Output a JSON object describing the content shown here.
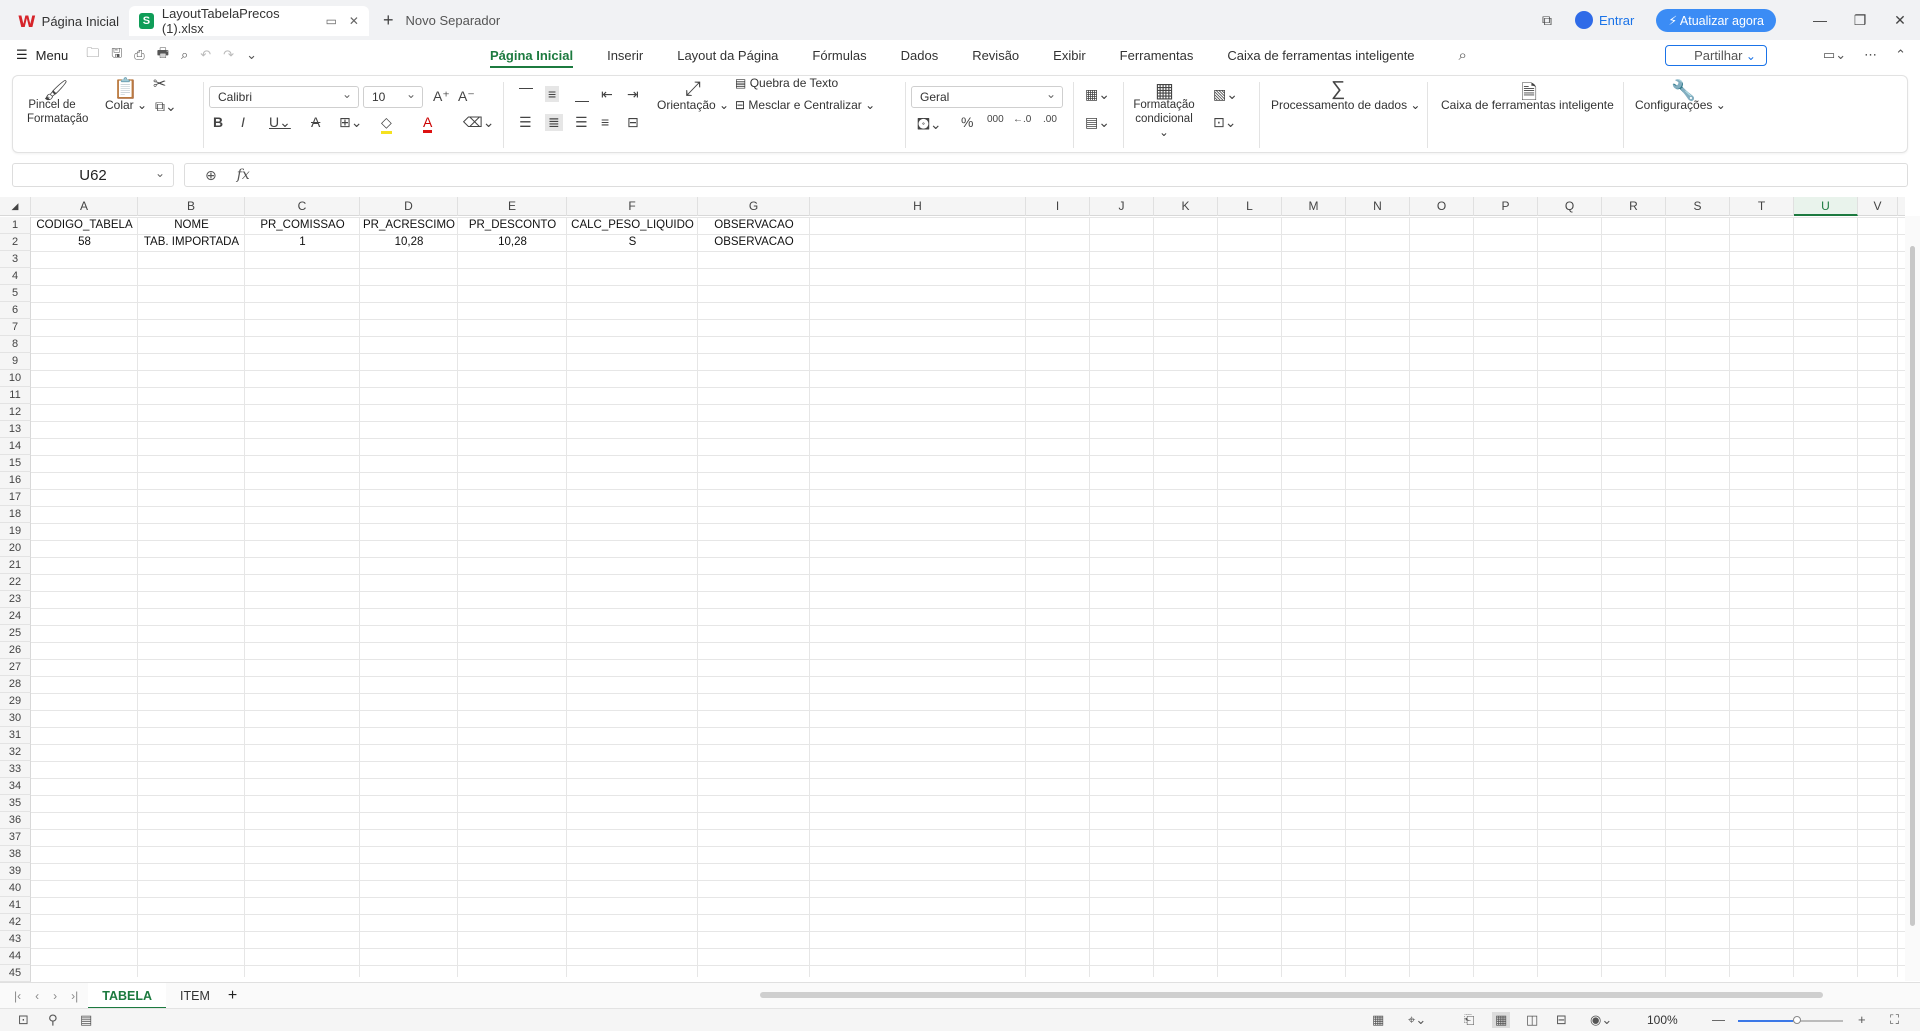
{
  "titlebar": {
    "home_tab": "Página Inicial",
    "doc_tab": "LayoutTabelaPrecos (1).xlsx",
    "new_tab": "Novo Separador",
    "signin": "Entrar",
    "upgrade": "Atualizar agora"
  },
  "menubar": {
    "menu": "Menu",
    "tabs": [
      "Página Inicial",
      "Inserir",
      "Layout da Página",
      "Fórmulas",
      "Dados",
      "Revisão",
      "Exibir",
      "Ferramentas",
      "Caixa de ferramentas inteligente"
    ],
    "share": "Partilhar"
  },
  "ribbon": {
    "format_painter": "Pincel de Formatação",
    "paste": "Colar",
    "font_name": "Calibri",
    "font_size": "10",
    "wrap_text": "Quebra de Texto",
    "orientation": "Orientação",
    "merge_center": "Mesclar e Centralizar",
    "number_format": "Geral",
    "cond_format": "Formatação condicional",
    "data_processing": "Processamento de dados",
    "smart_toolbox": "Caixa de ferramentas inteligente",
    "settings": "Configurações",
    "accent_color": "#1c7a3f"
  },
  "formula_bar": {
    "name_box": "U62",
    "fx": "fx",
    "value": ""
  },
  "columns": [
    "A",
    "B",
    "C",
    "D",
    "E",
    "F",
    "G",
    "H",
    "I",
    "J",
    "K",
    "L",
    "M",
    "N",
    "O",
    "P",
    "Q",
    "R",
    "S",
    "T",
    "U",
    "V"
  ],
  "selected_column": "U",
  "rows": [
    [
      "CODIGO_TABELA",
      "NOME",
      "PR_COMISSAO",
      "PR_ACRESCIMO",
      "PR_DESCONTO",
      "CALC_PESO_LIQUIDO",
      "OBSERVACAO"
    ],
    [
      "58",
      "TAB. IMPORTADA",
      "1",
      "10,28",
      "10,28",
      "S",
      "OBSERVACAO"
    ]
  ],
  "row_count": 45,
  "sheets": {
    "tabs": [
      "TABELA",
      "ITEM"
    ],
    "active": "TABELA"
  },
  "status": {
    "zoom": "100%"
  }
}
